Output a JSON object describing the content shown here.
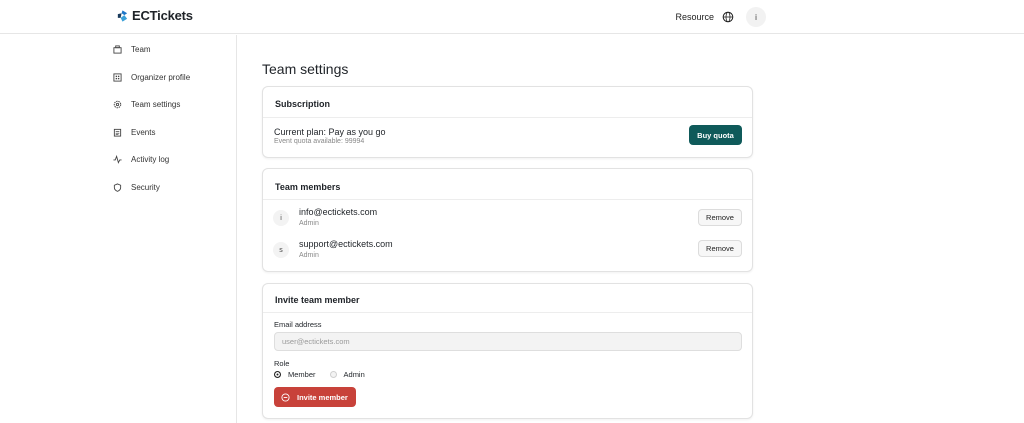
{
  "header": {
    "logo_text": "ECTickets",
    "resource_label": "Resource",
    "user_initial": "i"
  },
  "sidebar": {
    "items": [
      {
        "label": "Team",
        "icon": "team-icon"
      },
      {
        "label": "Organizer profile",
        "icon": "building-icon"
      },
      {
        "label": "Team settings",
        "icon": "gear-icon"
      },
      {
        "label": "Events",
        "icon": "calendar-icon"
      },
      {
        "label": "Activity log",
        "icon": "activity-icon"
      },
      {
        "label": "Security",
        "icon": "shield-icon"
      }
    ]
  },
  "main": {
    "title": "Team settings",
    "subscription": {
      "title": "Subscription",
      "plan_text": "Current plan: Pay as you go",
      "quota_text": "Event quota available: 99994",
      "buy_label": "Buy quota"
    },
    "members": {
      "title": "Team members",
      "list": [
        {
          "initial": "i",
          "email": "info@ectickets.com",
          "role": "Admin",
          "remove_label": "Remove"
        },
        {
          "initial": "s",
          "email": "support@ectickets.com",
          "role": "Admin",
          "remove_label": "Remove"
        }
      ]
    },
    "invite": {
      "title": "Invite team member",
      "email_label": "Email address",
      "email_placeholder": "user@ectickets.com",
      "role_label": "Role",
      "role_options": [
        "Member",
        "Admin"
      ],
      "selected_role": "Member",
      "invite_label": "Invite member"
    }
  },
  "colors": {
    "primary": "#0f5a5a",
    "danger": "#c8423a",
    "logo_blue": "#1f76c8"
  }
}
